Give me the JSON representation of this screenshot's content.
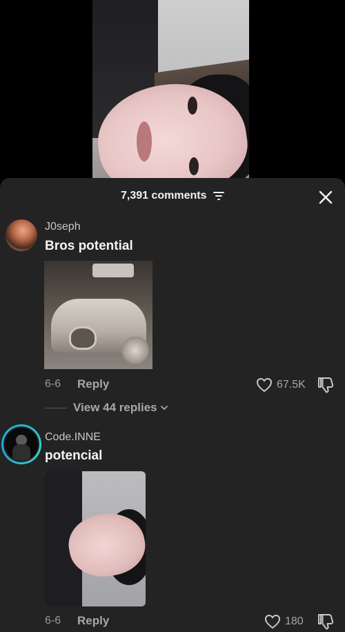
{
  "header": {
    "comment_count_label": "7,391 comments",
    "filter_icon": "sort-filter-icon",
    "close_icon": "close-icon"
  },
  "comments": [
    {
      "username": "J0seph",
      "text": "Bros potential",
      "image": "dusty-car-photo",
      "date": "6-6",
      "reply_label": "Reply",
      "likes": "67.5K",
      "view_replies_label": "View 44 replies"
    },
    {
      "username": "Code.INNE",
      "text": "potencial",
      "image": "face-selfie-photo",
      "date": "6-6",
      "reply_label": "Reply",
      "likes": "180"
    }
  ],
  "colors": {
    "panel_bg": "#232323",
    "text_primary": "#f4f4f4",
    "text_secondary": "#a8a8a8",
    "story_ring": "#1fb6d6"
  }
}
